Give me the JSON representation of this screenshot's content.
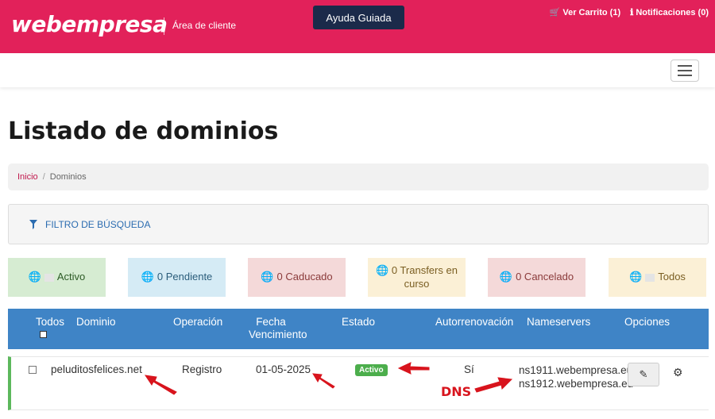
{
  "header": {
    "logo": "webempresa",
    "subtitle": "Área de cliente",
    "help_button": "Ayuda Guiada",
    "cart_link": "Ver Carrito (1)",
    "notifications_link": "Notificaciones (0)",
    "colors": {
      "brand": "#e2215a",
      "help_button": "#1b2a4a"
    }
  },
  "page": {
    "title": "Listado de dominios"
  },
  "breadcrumb": {
    "home": "Inicio",
    "separator": "/",
    "current": "Dominios"
  },
  "filter": {
    "label": "FILTRO DE BÚSQUEDA",
    "icon": "funnel-icon"
  },
  "status_cards": {
    "activo": "Activo",
    "pendiente": "0 Pendiente",
    "caducado": "0 Caducado",
    "transfers": "0 Transfers en curso",
    "cancelado": "0 Cancelado",
    "todos": "Todos"
  },
  "table": {
    "headers": {
      "todos": "Todos",
      "dominio": "Dominio",
      "operacion": "Operación",
      "fecha": "Fecha Vencimiento",
      "estado": "Estado",
      "autorrenovacion": "Autorrenovación",
      "nameservers": "Nameservers",
      "opciones": "Opciones"
    },
    "rows": [
      {
        "dominio": "peluditosfelices.net",
        "operacion": "Registro",
        "fecha": "01-05-2025",
        "estado": "Activo",
        "autorrenovacion": "Sí",
        "ns1": "ns1911.webempresa.eu",
        "ns2": "ns1912.webempresa.eu"
      }
    ]
  },
  "annotation": {
    "dns_label": "DNS",
    "arrow_color": "#d8141d"
  }
}
